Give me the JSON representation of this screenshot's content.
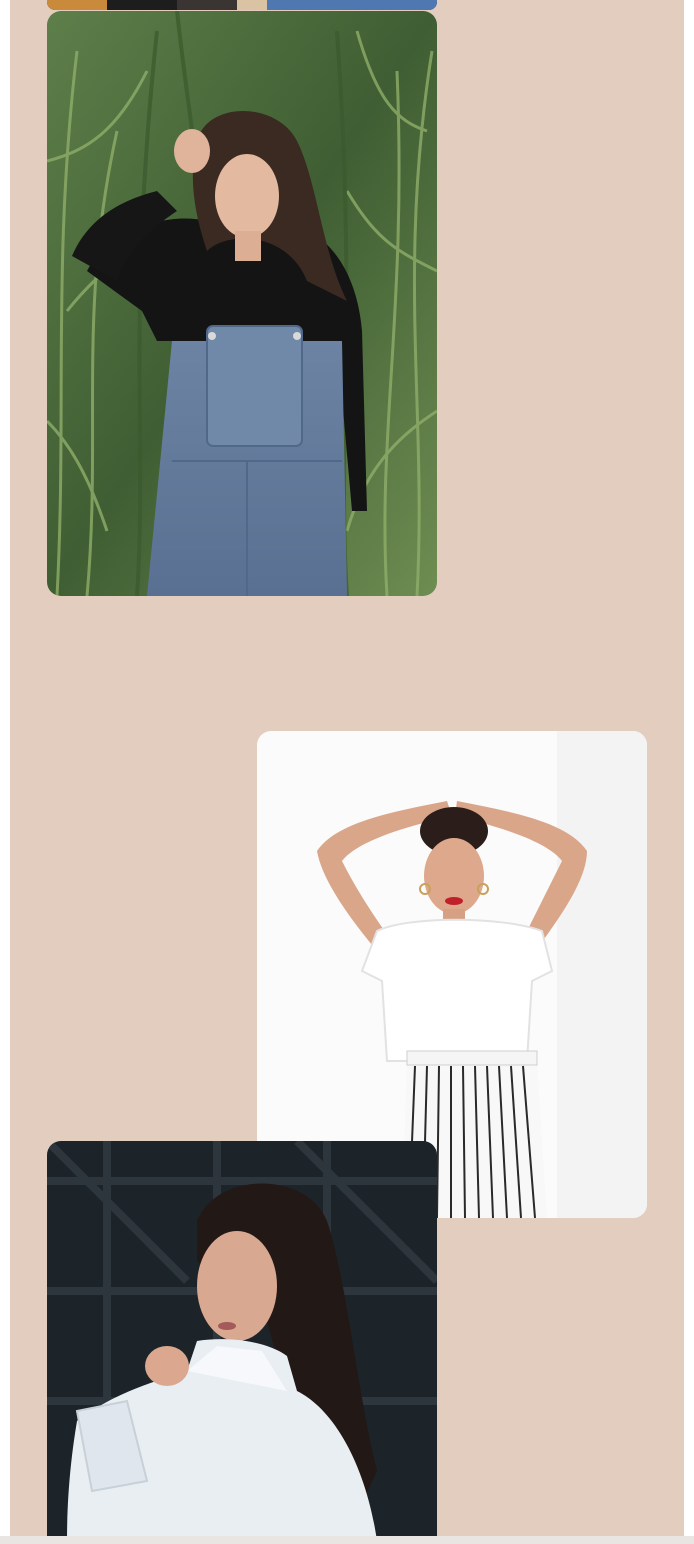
{
  "gallery": {
    "photos": [
      {
        "subject": "partial-photo-top",
        "alt": ""
      },
      {
        "subject": "woman-in-denim-overalls",
        "alt": ""
      },
      {
        "subject": "woman-in-white-tee-striped-pants",
        "alt": ""
      },
      {
        "subject": "woman-in-white-shirt",
        "alt": ""
      }
    ]
  },
  "colors": {
    "page_background": "#e2cdbf",
    "card_radius_style": "rounded"
  }
}
